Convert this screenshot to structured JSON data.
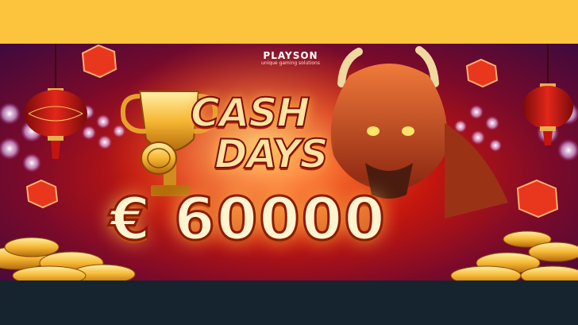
{
  "brand": {
    "name": "PLAYSON",
    "tagline": "unique gaming solutions"
  },
  "promo": {
    "title_line1": "CASH",
    "title_line2": "DAYS",
    "prize": "€ 60000"
  },
  "colors": {
    "top_band": "#fcc43c",
    "bottom_band": "#16242f",
    "title_fill": "#ffe3a0",
    "prize_fill": "#fff4d0",
    "brand_accent": "#6bd4ff"
  },
  "icons": [
    "lantern-icon",
    "trophy-icon",
    "coin-icon",
    "bison-icon",
    "hexagon-coin-icon",
    "stadium-light-icon"
  ]
}
